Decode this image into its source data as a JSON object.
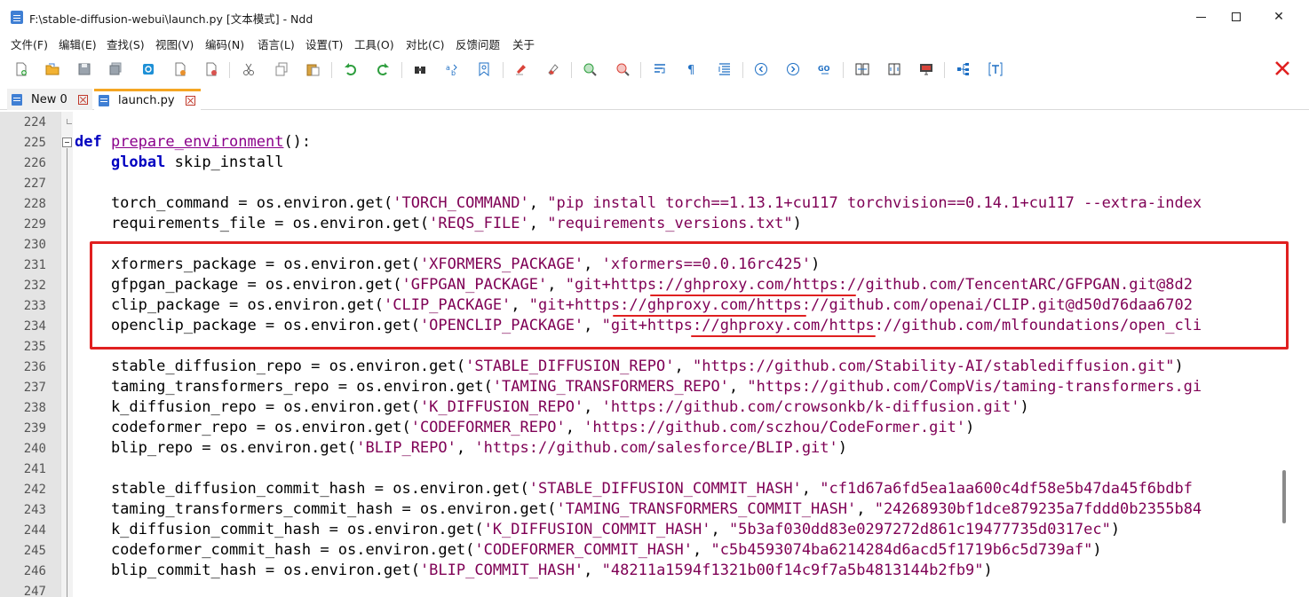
{
  "window": {
    "title": "F:\\stable-diffusion-webui\\launch.py [文本模式] - Ndd",
    "minimize": "—",
    "maximize": "☐",
    "close": "✕"
  },
  "menu": {
    "items": [
      "文件(F)",
      "编辑(E)",
      "查找(S)",
      "视图(V)",
      "编码(N)",
      "语言(L)",
      "设置(T)",
      "工具(O)",
      "对比(C)",
      "反馈问题",
      "关于"
    ]
  },
  "toolbar": {
    "icons": [
      "new-file-icon",
      "open-file-icon",
      "save-icon",
      "save-all-icon",
      "reload-icon",
      "close-file-icon",
      "close-all-icon",
      "cut-icon",
      "copy-icon",
      "paste-icon",
      "undo-icon",
      "redo-icon",
      "find-icon",
      "replace-icon",
      "bookmark-icon",
      "mark-icon",
      "clear-mark-icon",
      "zoom-in-icon",
      "zoom-out-icon",
      "word-wrap-icon",
      "show-symbols-icon",
      "indent-guide-icon",
      "prev-icon",
      "next-icon",
      "goto-icon",
      "compare-icon",
      "split-view-icon",
      "monitor-icon",
      "tree-icon",
      "text-mode-icon"
    ],
    "close_icon": "close-red-x-icon",
    "accent_color": "#e02020"
  },
  "tabs": [
    {
      "label": "New 0",
      "active": false
    },
    {
      "label": "launch.py",
      "active": true
    }
  ],
  "editor": {
    "lines": [
      {
        "num": "224",
        "code": ""
      },
      {
        "num": "225",
        "code": "def prepare_environment():"
      },
      {
        "num": "226",
        "code": "    global skip_install"
      },
      {
        "num": "227",
        "code": ""
      },
      {
        "num": "228",
        "code": "    torch_command = os.environ.get('TORCH_COMMAND', \"pip install torch==1.13.1+cu117 torchvision==0.14.1+cu117 --extra-index"
      },
      {
        "num": "229",
        "code": "    requirements_file = os.environ.get('REQS_FILE', \"requirements_versions.txt\")"
      },
      {
        "num": "230",
        "code": ""
      },
      {
        "num": "231",
        "code": "    xformers_package = os.environ.get('XFORMERS_PACKAGE', 'xformers==0.0.16rc425')"
      },
      {
        "num": "232",
        "code": "    gfpgan_package = os.environ.get('GFPGAN_PACKAGE', \"git+https://ghproxy.com/https://github.com/TencentARC/GFPGAN.git@8d2"
      },
      {
        "num": "233",
        "code": "    clip_package = os.environ.get('CLIP_PACKAGE', \"git+https://ghproxy.com/https://github.com/openai/CLIP.git@d50d76daa6702"
      },
      {
        "num": "234",
        "code": "    openclip_package = os.environ.get('OPENCLIP_PACKAGE', \"git+https://ghproxy.com/https://github.com/mlfoundations/open_cli"
      },
      {
        "num": "235",
        "code": ""
      },
      {
        "num": "236",
        "code": "    stable_diffusion_repo = os.environ.get('STABLE_DIFFUSION_REPO', \"https://github.com/Stability-AI/stablediffusion.git\")"
      },
      {
        "num": "237",
        "code": "    taming_transformers_repo = os.environ.get('TAMING_TRANSFORMERS_REPO', \"https://github.com/CompVis/taming-transformers.gi"
      },
      {
        "num": "238",
        "code": "    k_diffusion_repo = os.environ.get('K_DIFFUSION_REPO', 'https://github.com/crowsonkb/k-diffusion.git')"
      },
      {
        "num": "239",
        "code": "    codeformer_repo = os.environ.get('CODEFORMER_REPO', 'https://github.com/sczhou/CodeFormer.git')"
      },
      {
        "num": "240",
        "code": "    blip_repo = os.environ.get('BLIP_REPO', 'https://github.com/salesforce/BLIP.git')"
      },
      {
        "num": "241",
        "code": ""
      },
      {
        "num": "242",
        "code": "    stable_diffusion_commit_hash = os.environ.get('STABLE_DIFFUSION_COMMIT_HASH', \"cf1d67a6fd5ea1aa600c4df58e5b47da45f6bdbf"
      },
      {
        "num": "243",
        "code": "    taming_transformers_commit_hash = os.environ.get('TAMING_TRANSFORMERS_COMMIT_HASH', \"24268930bf1dce879235a7fddd0b2355b84"
      },
      {
        "num": "244",
        "code": "    k_diffusion_commit_hash = os.environ.get('K_DIFFUSION_COMMIT_HASH', \"5b3af030dd83e0297272d861c19477735d0317ec\")"
      },
      {
        "num": "245",
        "code": "    codeformer_commit_hash = os.environ.get('CODEFORMER_COMMIT_HASH', \"c5b4593074ba6214284d6acd5f1719b6c5d739af\")"
      },
      {
        "num": "246",
        "code": "    blip_commit_hash = os.environ.get('BLIP_COMMIT_HASH', \"48211a1594f1321b00f14c9f7a5b4813144b2fb9\")"
      },
      {
        "num": "247",
        "code": ""
      }
    ]
  },
  "annotation": {
    "box_color": "#e02020"
  }
}
